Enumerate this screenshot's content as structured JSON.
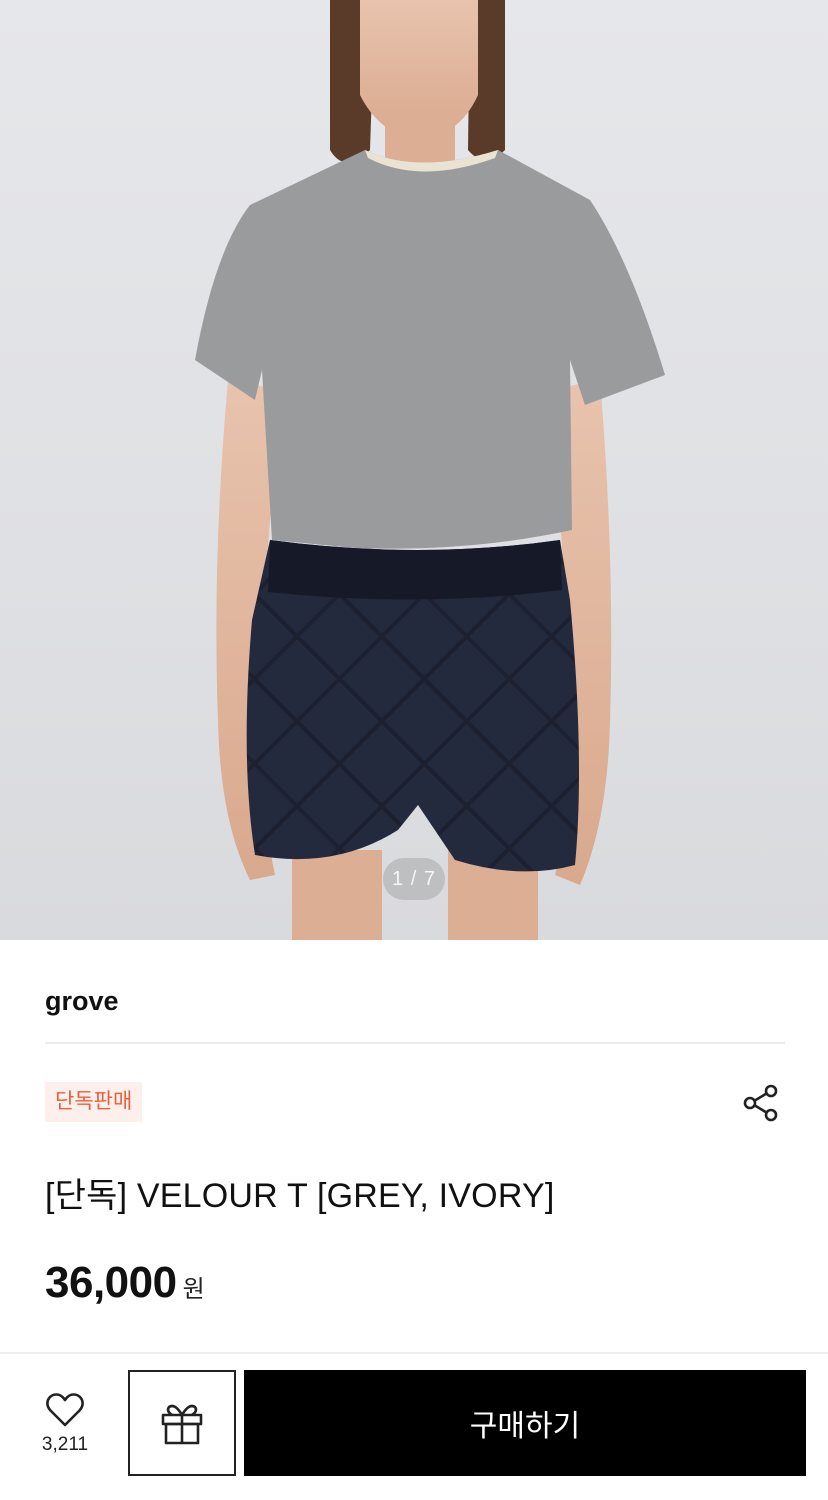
{
  "gallery": {
    "current_page": 1,
    "total_pages": 7,
    "indicator": "1 / 7",
    "colors": {
      "background": "#e2e3e6",
      "tshirt": "#9a9b9d",
      "shorts": "#1c2030"
    }
  },
  "product": {
    "brand": "grove",
    "badge": "단독판매",
    "title": "[단독] VELOUR T [GREY, IVORY]",
    "price": "36,000",
    "currency": "원",
    "share_icon": "share-icon"
  },
  "actions": {
    "like_icon": "heart-icon",
    "like_count": "3,211",
    "gift_icon": "gift-icon",
    "buy_label": "구매하기"
  },
  "colors": {
    "badge_text": "#e4613d",
    "badge_bg": "#fdf0ec",
    "buy_button_bg": "#000000",
    "text": "#111111"
  }
}
